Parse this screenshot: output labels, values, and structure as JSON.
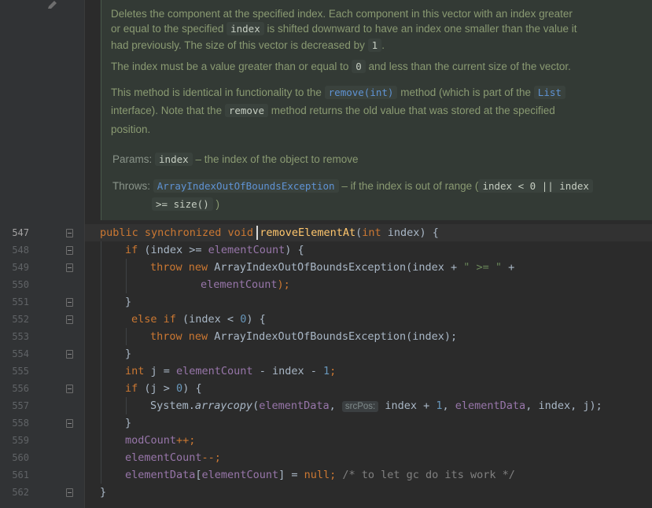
{
  "doc": {
    "p1": [
      "Deletes the component at the specified index. Each component in this vector with an index greater",
      {
        "pre": "or equal to the specified ",
        "code": "index",
        "post": " is shifted downward to have an index one smaller than the value it"
      },
      {
        "pre": "had previously. The size of this vector is decreased by ",
        "code": "1",
        "post": "."
      }
    ],
    "p2": {
      "pre": "The index must be a value greater than or equal to ",
      "code": "0",
      "post": " and less than the current size of the vector."
    },
    "p3a": {
      "pre": "This method is identical in functionality to the ",
      "link1": "remove(int)",
      "mid": " method (which is part of the ",
      "link2": "List"
    },
    "p3b": {
      "pre": "interface). Note that the ",
      "code": "remove",
      "post": " method returns the old value that was stored at the specified"
    },
    "p3c": "position.",
    "params": {
      "label": "Params:",
      "code": "index",
      "text": "– the index of the object to remove"
    },
    "throws": {
      "label": "Throws:",
      "link": "ArrayIndexOutOfBoundsException",
      "text": "– if the index is out of range (",
      "code1": "index < 0 || index",
      "code2": ">= size()",
      "close": ")"
    }
  },
  "line_numbers": [
    "547",
    "548",
    "549",
    "550",
    "551",
    "552",
    "553",
    "554",
    "555",
    "556",
    "557",
    "558",
    "559",
    "560",
    "561",
    "562"
  ],
  "current_line": "547",
  "code": {
    "l547": {
      "kw": "public synchronized void",
      "fn": "removeElementAt",
      "paren": "(",
      "kw2": "int",
      "rest": " index) {"
    },
    "l548": {
      "kw": "if",
      "a": " (index >= ",
      "fld": "elementCount",
      "b": ") {"
    },
    "l549": {
      "kw": "throw new",
      "a": " ArrayIndexOutOfBoundsException(index + ",
      "str": "\" >= \"",
      "b": " +"
    },
    "l550": {
      "fld": "elementCount",
      "b": ");"
    },
    "l551": "}",
    "l552": {
      "kw": "else if",
      "a": " (index < ",
      "num": "0",
      "b": ") {"
    },
    "l553": {
      "kw": "throw new",
      "a": " ArrayIndexOutOfBoundsException(index);"
    },
    "l554": "}",
    "l555": {
      "kw": "int",
      "a": " j = ",
      "fld": "elementCount",
      "b": " - index - ",
      "num": "1",
      "c": ";"
    },
    "l556": {
      "kw": "if",
      "a": " (j > ",
      "num": "0",
      "b": ") {"
    },
    "l557": {
      "a": "System.",
      "fn": "arraycopy",
      "b": "(",
      "fld": "elementData",
      "c": ", ",
      "hint": "srcPos:",
      "d": " index + ",
      "num": "1",
      "e": ", ",
      "fld2": "elementData",
      "f": ", index, j);"
    },
    "l558": "}",
    "l559": {
      "fld": "modCount",
      "a": "++;"
    },
    "l560": {
      "fld": "elementCount",
      "a": "--;"
    },
    "l561": {
      "fld": "elementData",
      "a": "[",
      "fld2": "elementCount",
      "b": "] = ",
      "kw": "null",
      "c": "; ",
      "cmt": "/* to let gc do its work */"
    },
    "l562": "}"
  },
  "colors": {
    "background": "#2b2b2b",
    "gutter": "#313335",
    "doc_background": "#333a35",
    "keyword": "#cc7832",
    "field": "#9876aa",
    "number": "#6897bb",
    "string": "#6a8759",
    "comment": "#808080",
    "method": "#ffc66d"
  }
}
